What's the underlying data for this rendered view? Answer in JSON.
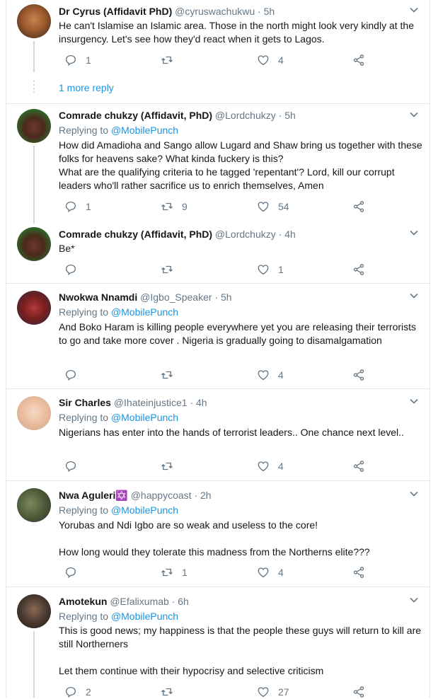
{
  "colors": {
    "link": "#1b95e0",
    "meta": "#657786",
    "border": "#e1e8ed",
    "text": "#14171a"
  },
  "tweets": [
    {
      "name": "Dr Cyrus (Affidavit PhD)",
      "handle": "@cyruswachukwu",
      "time": "5h",
      "text": [
        "He can't Islamise an Islamic area. Those in the north might look very kindly at the insurgency. Let's see how they'd react when it gets to Lagos."
      ],
      "replies": "1",
      "retweets": "",
      "likes": "4",
      "more_reply": "1 more reply"
    },
    {
      "name": "Comrade chukzy (Affidavit, PhD)",
      "handle": "@Lordchukzy",
      "time": "5h",
      "replying_label": "Replying to",
      "replying_to": "@MobilePunch",
      "text": [
        "How did Amadioha and Sango allow Lugard and Shaw bring us together with these folks for heavens sake? What kinda fuckery is this?",
        "What are the qualifying criteria to he tagged 'repentant'? Lord, kill our corrupt leaders who'll rather sacrifice us to enrich themselves, Amen"
      ],
      "replies": "1",
      "retweets": "9",
      "likes": "54"
    },
    {
      "name": "Comrade chukzy (Affidavit, PhD)",
      "handle": "@Lordchukzy",
      "time": "4h",
      "text": [
        "Be*"
      ],
      "replies": "",
      "retweets": "",
      "likes": "1"
    },
    {
      "name": "Nwokwa Nnamdi",
      "handle": "@Igbo_Speaker",
      "time": "5h",
      "replying_label": "Replying to",
      "replying_to": "@MobilePunch",
      "text": [
        "And Boko Haram is killing people everywhere yet you are releasing their terrorists to go and take more cover . Nigeria is gradually going to disamalgamation"
      ],
      "replies": "",
      "retweets": "",
      "likes": "4"
    },
    {
      "name": "Sir Charles",
      "handle": "@Ihateinjustice1",
      "time": "4h",
      "replying_label": "Replying to",
      "replying_to": "@MobilePunch",
      "text": [
        "Nigerians has enter into the hands of terrorist leaders.. One chance next level.."
      ],
      "replies": "",
      "retweets": "",
      "likes": "4"
    },
    {
      "name": "Nwa Aguleri✡️",
      "handle": "@happycoast",
      "time": "2h",
      "replying_label": "Replying to",
      "replying_to": "@MobilePunch",
      "text": [
        "Yorubas and Ndi Igbo are so weak and useless to the core!",
        "",
        "How long would they tolerate this madness from the Northerns elite???"
      ],
      "replies": "",
      "retweets": "1",
      "likes": "4"
    },
    {
      "name": "Amotekun",
      "handle": "@Efalixumab",
      "time": "6h",
      "replying_label": "Replying to",
      "replying_to": "@MobilePunch",
      "text": [
        "This is good news; my happiness is that the people these guys will return to kill are still Northerners",
        "",
        "Let them continue with their hypocrisy and selective criticism"
      ],
      "replies": "2",
      "retweets": "",
      "likes": "27"
    }
  ],
  "icons": [
    "reply-icon",
    "retweet-icon",
    "like-icon",
    "share-icon",
    "caret-down-icon"
  ]
}
